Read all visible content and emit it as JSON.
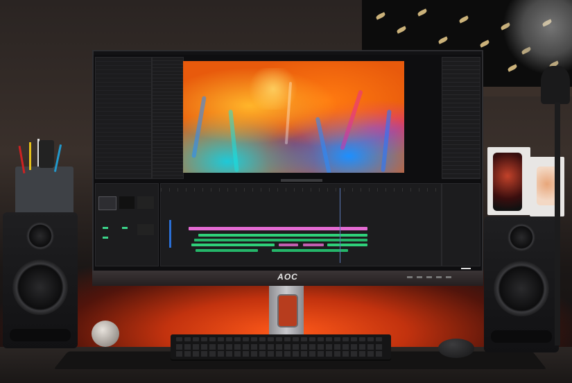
{
  "monitor": {
    "brand": "AOC"
  },
  "scene": {
    "objects": [
      "monitor",
      "keyboard",
      "mouse",
      "left-speaker",
      "right-speaker",
      "pen-cup",
      "phone-boxes",
      "desk-lamp",
      "wall-artwork",
      "ball"
    ],
    "accent_colors": {
      "glow": "#ff5a1a",
      "timeline_pink": "#e46bd3",
      "timeline_green": "#2fd07a",
      "preview_orange": "#e85a0c"
    }
  }
}
